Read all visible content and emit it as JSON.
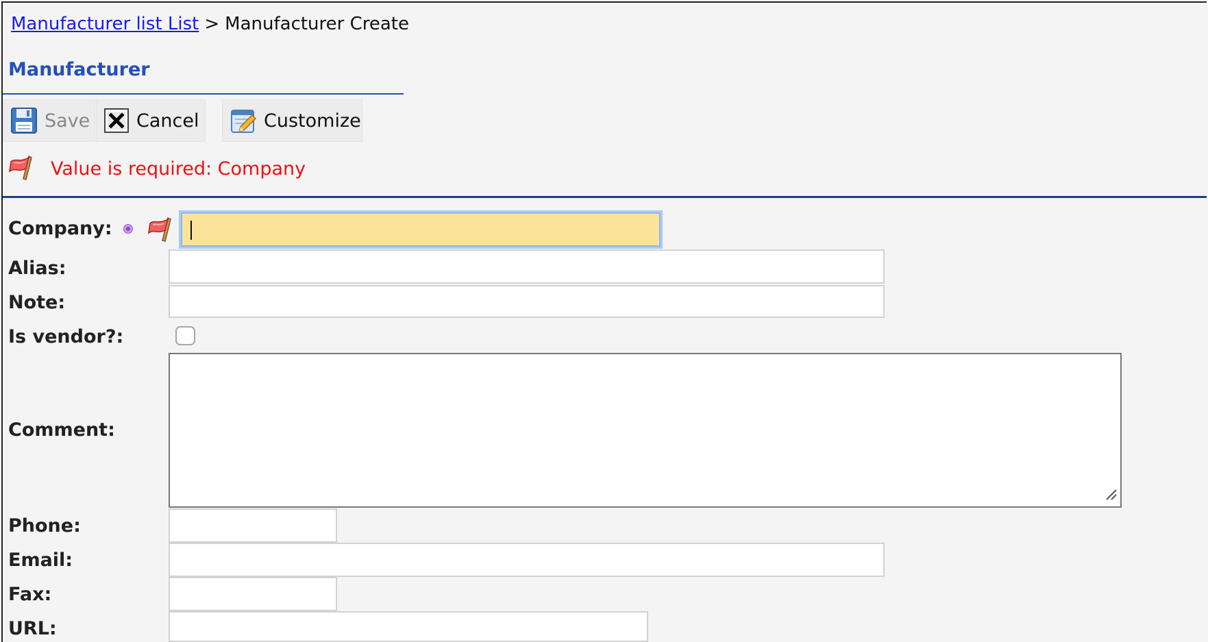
{
  "breadcrumb": {
    "parent_link": "Manufacturer list List",
    "separator": ">",
    "current": "Manufacturer Create"
  },
  "section": {
    "title": "Manufacturer"
  },
  "toolbar": {
    "save_label": "Save",
    "cancel_label": "Cancel",
    "customize_label": "Customize"
  },
  "error": {
    "message": "Value is required: Company"
  },
  "form": {
    "company_label": "Company:",
    "company_value": "",
    "alias_label": "Alias:",
    "alias_value": "",
    "note_label": "Note:",
    "note_value": "",
    "is_vendor_label": "Is vendor?:",
    "is_vendor_checked": false,
    "comment_label": "Comment:",
    "comment_value": "",
    "phone_label": "Phone:",
    "phone_value": "",
    "email_label": "Email:",
    "email_value": "",
    "fax_label": "Fax:",
    "fax_value": "",
    "url_label": "URL:",
    "url_value": ""
  },
  "colors": {
    "link": "#1a1aee",
    "section_title": "#2450b8",
    "error_text": "#ee1111",
    "focused_input_bg": "#fbe29a",
    "divider": "#1c3f8a",
    "required_marker": "#8a3fcf"
  },
  "icons": {
    "save": "floppy-disk-icon",
    "cancel": "close-box-icon",
    "customize": "customize-pencil-icon",
    "error_flag": "red-flag-icon",
    "required": "required-dot-icon"
  }
}
